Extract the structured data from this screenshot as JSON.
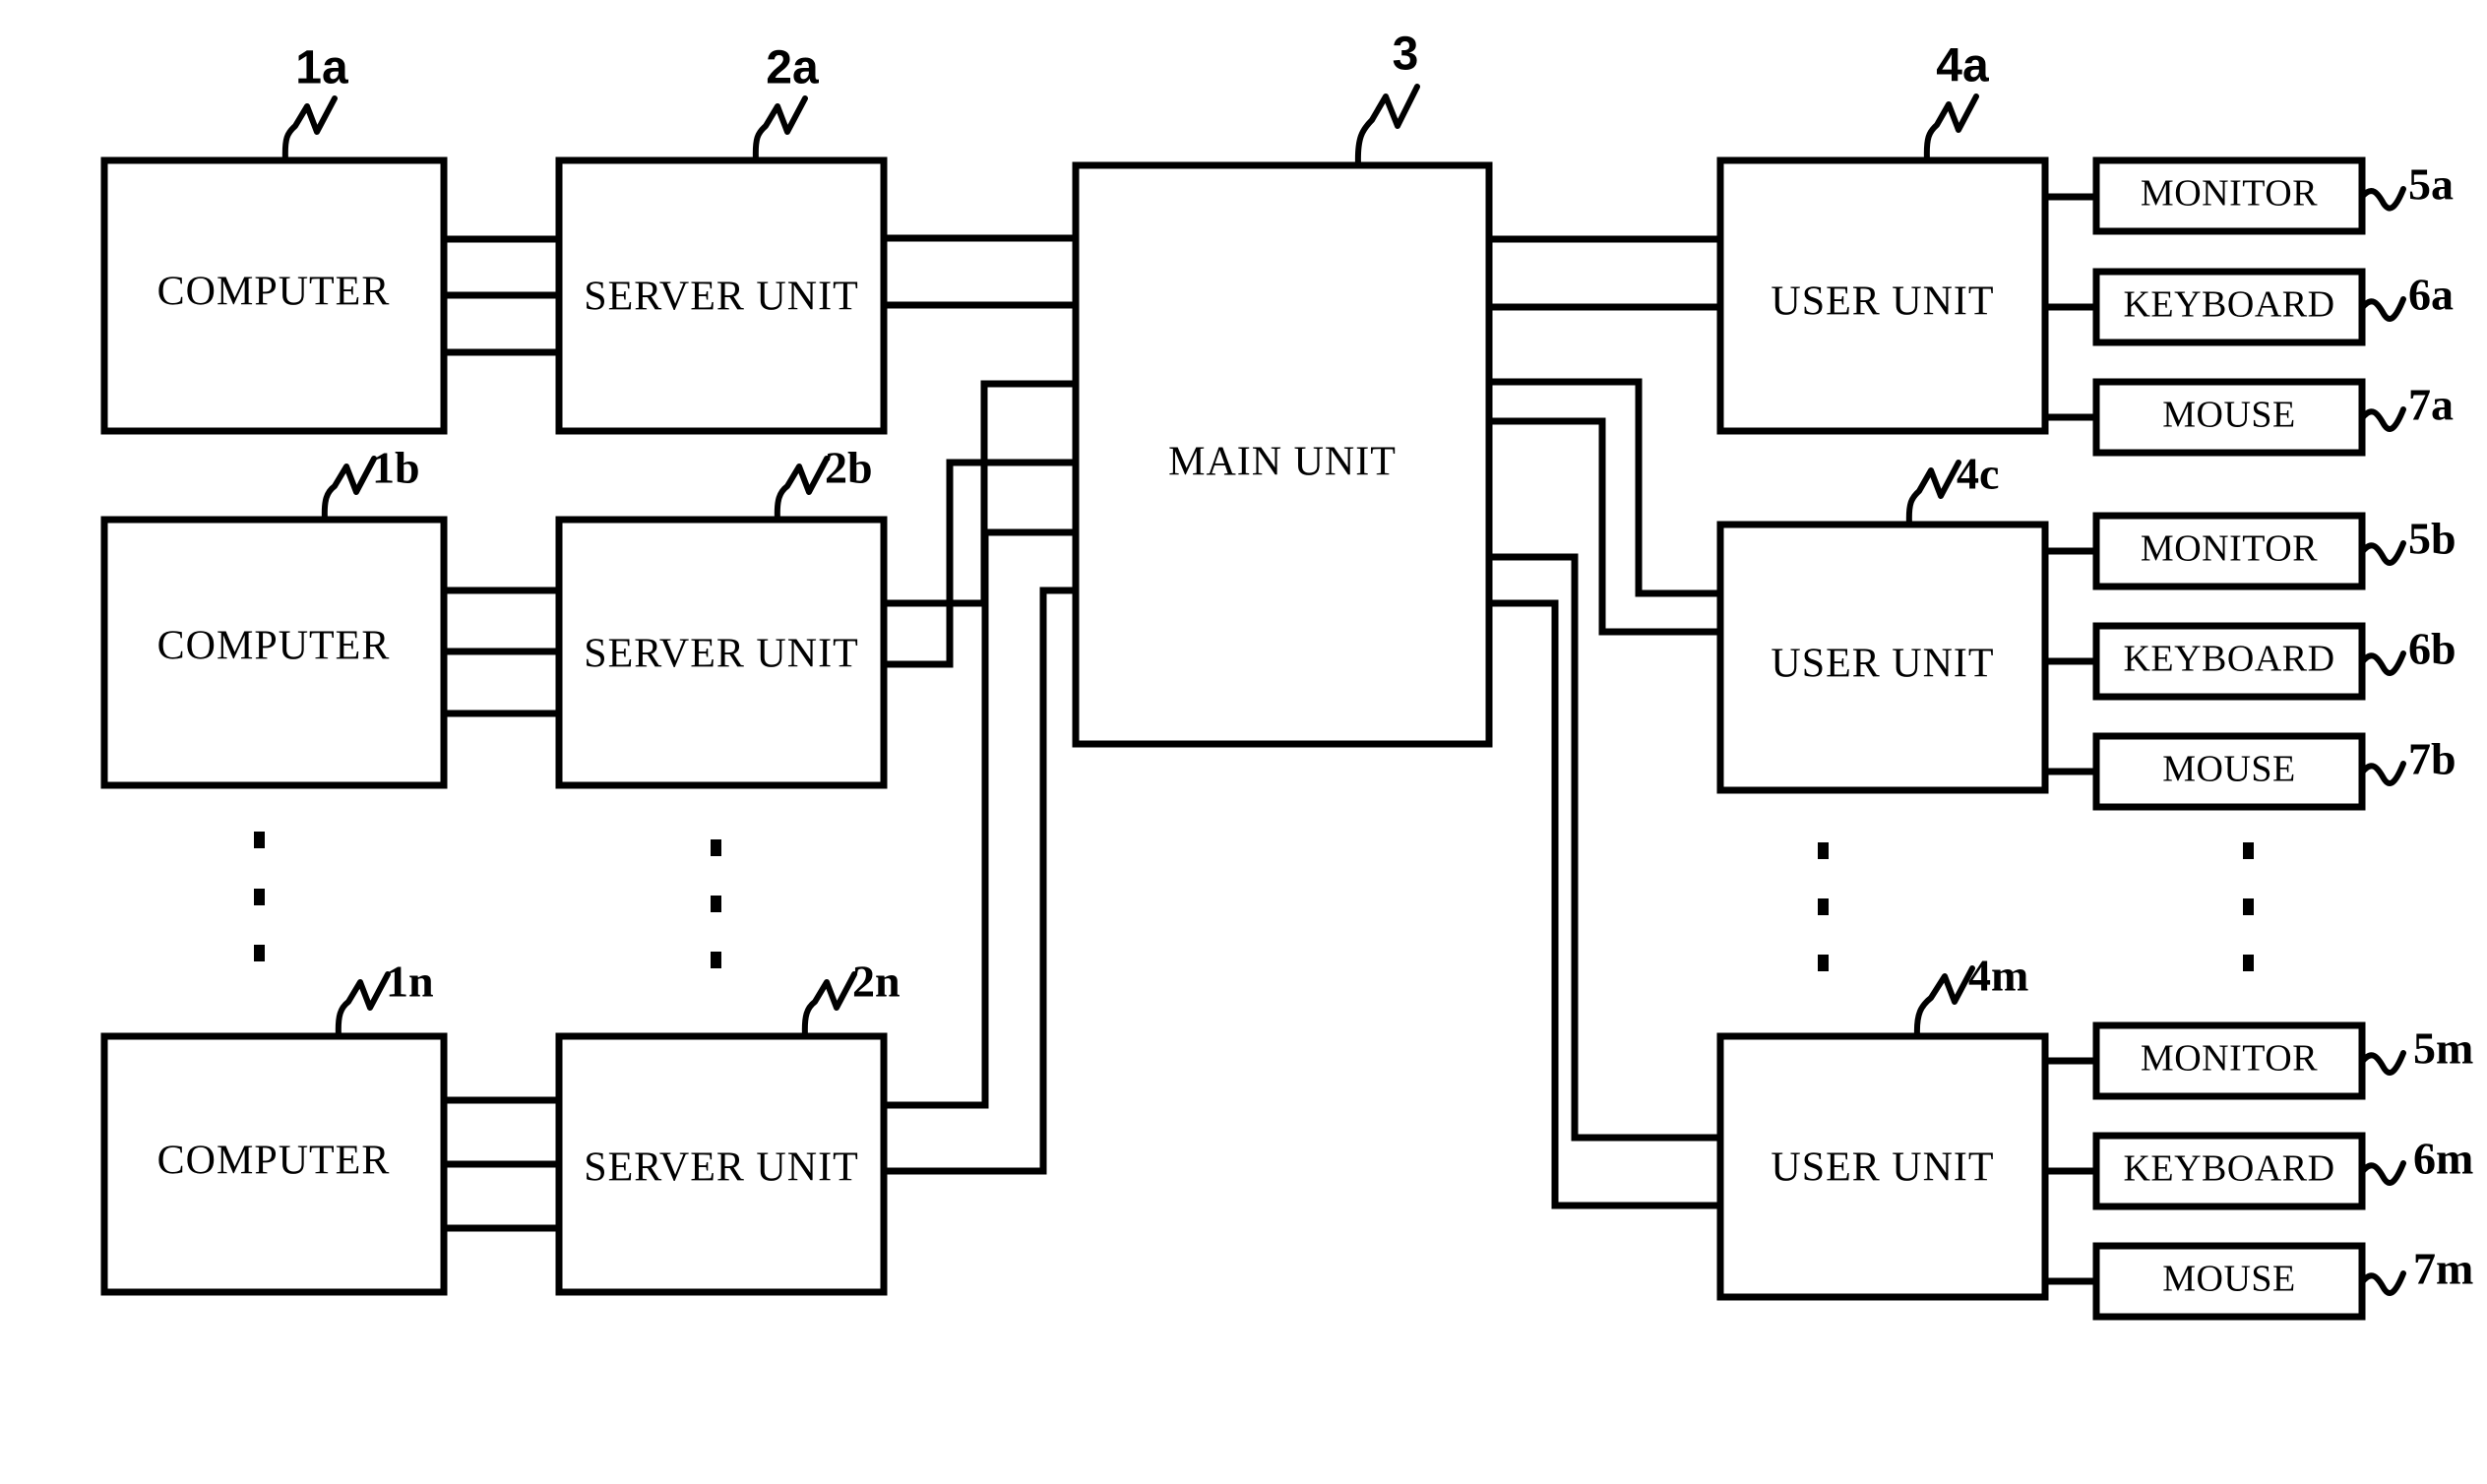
{
  "figure": {
    "type": "patent-block-diagram",
    "background_color": "#ffffff",
    "line_color": "#000000"
  },
  "blocks": {
    "computers": [
      {
        "label": "COMPUTER",
        "ref": "1a"
      },
      {
        "label": "COMPUTER",
        "ref": "1b"
      },
      {
        "label": "COMPUTER",
        "ref": "1n"
      }
    ],
    "servers": [
      {
        "label": "SERVER UNIT",
        "ref": "2a"
      },
      {
        "label": "SERVER UNIT",
        "ref": "2b"
      },
      {
        "label": "SERVER UNIT",
        "ref": "2n"
      }
    ],
    "main": {
      "label": "MAIN UNIT",
      "ref": "3"
    },
    "users": [
      {
        "label": "USER UNIT",
        "ref": "4a"
      },
      {
        "label": "USER UNIT",
        "ref": "4c"
      },
      {
        "label": "USER UNIT",
        "ref": "4m"
      }
    ],
    "peripherals": [
      {
        "group": "a",
        "items": [
          {
            "label": "MONITOR",
            "ref": "5a"
          },
          {
            "label": "KEYBOARD",
            "ref": "6a"
          },
          {
            "label": "MOUSE",
            "ref": "7a"
          }
        ]
      },
      {
        "group": "b",
        "items": [
          {
            "label": "MONITOR",
            "ref": "5b"
          },
          {
            "label": "KEYBOARD",
            "ref": "6b"
          },
          {
            "label": "MOUSE",
            "ref": "7b"
          }
        ]
      },
      {
        "group": "m",
        "items": [
          {
            "label": "MONITOR",
            "ref": "5m"
          },
          {
            "label": "KEYBOARD",
            "ref": "6m"
          },
          {
            "label": "MOUSE",
            "ref": "7m"
          }
        ]
      }
    ]
  },
  "ellipses": {
    "marker": "•",
    "columns": [
      "computer-column",
      "server-column",
      "user-column",
      "peripheral-column"
    ]
  }
}
